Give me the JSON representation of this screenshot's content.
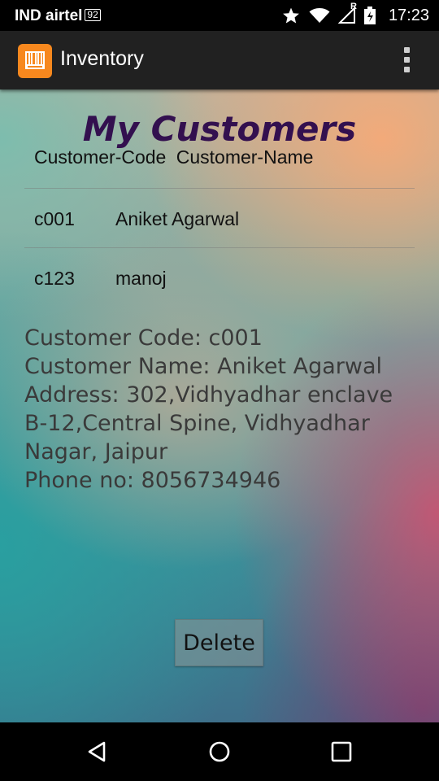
{
  "status_bar": {
    "carrier": "IND airtel",
    "carrier_badge": "92",
    "roaming_indicator": "R",
    "time": "17:23",
    "icons": [
      "star-icon",
      "wifi-icon",
      "signal-icon",
      "battery-icon"
    ]
  },
  "action_bar": {
    "title": "Inventory",
    "app_icon": "barcode-icon",
    "menu_icon": "overflow-menu-icon",
    "accent_color": "#f7881e"
  },
  "main": {
    "title": "My Customers",
    "columns": [
      "Customer-Code",
      "Customer-Name"
    ],
    "rows": [
      {
        "code": "c001",
        "name": "Aniket Agarwal"
      },
      {
        "code": "c123",
        "name": "manoj"
      }
    ],
    "details": {
      "line1": "Customer Code: c001",
      "line2": "Customer Name: Aniket Agarwal",
      "line3": "Address: 302,Vidhyadhar enclave",
      "line4": "B-12,Central Spine, Vidhyadhar",
      "line5": "Nagar, Jaipur",
      "line6": "Phone no: 8056734946"
    },
    "delete_label": "Delete"
  },
  "nav_bar": {
    "back_icon": "back-icon",
    "home_icon": "home-icon",
    "recents_icon": "recents-icon"
  }
}
